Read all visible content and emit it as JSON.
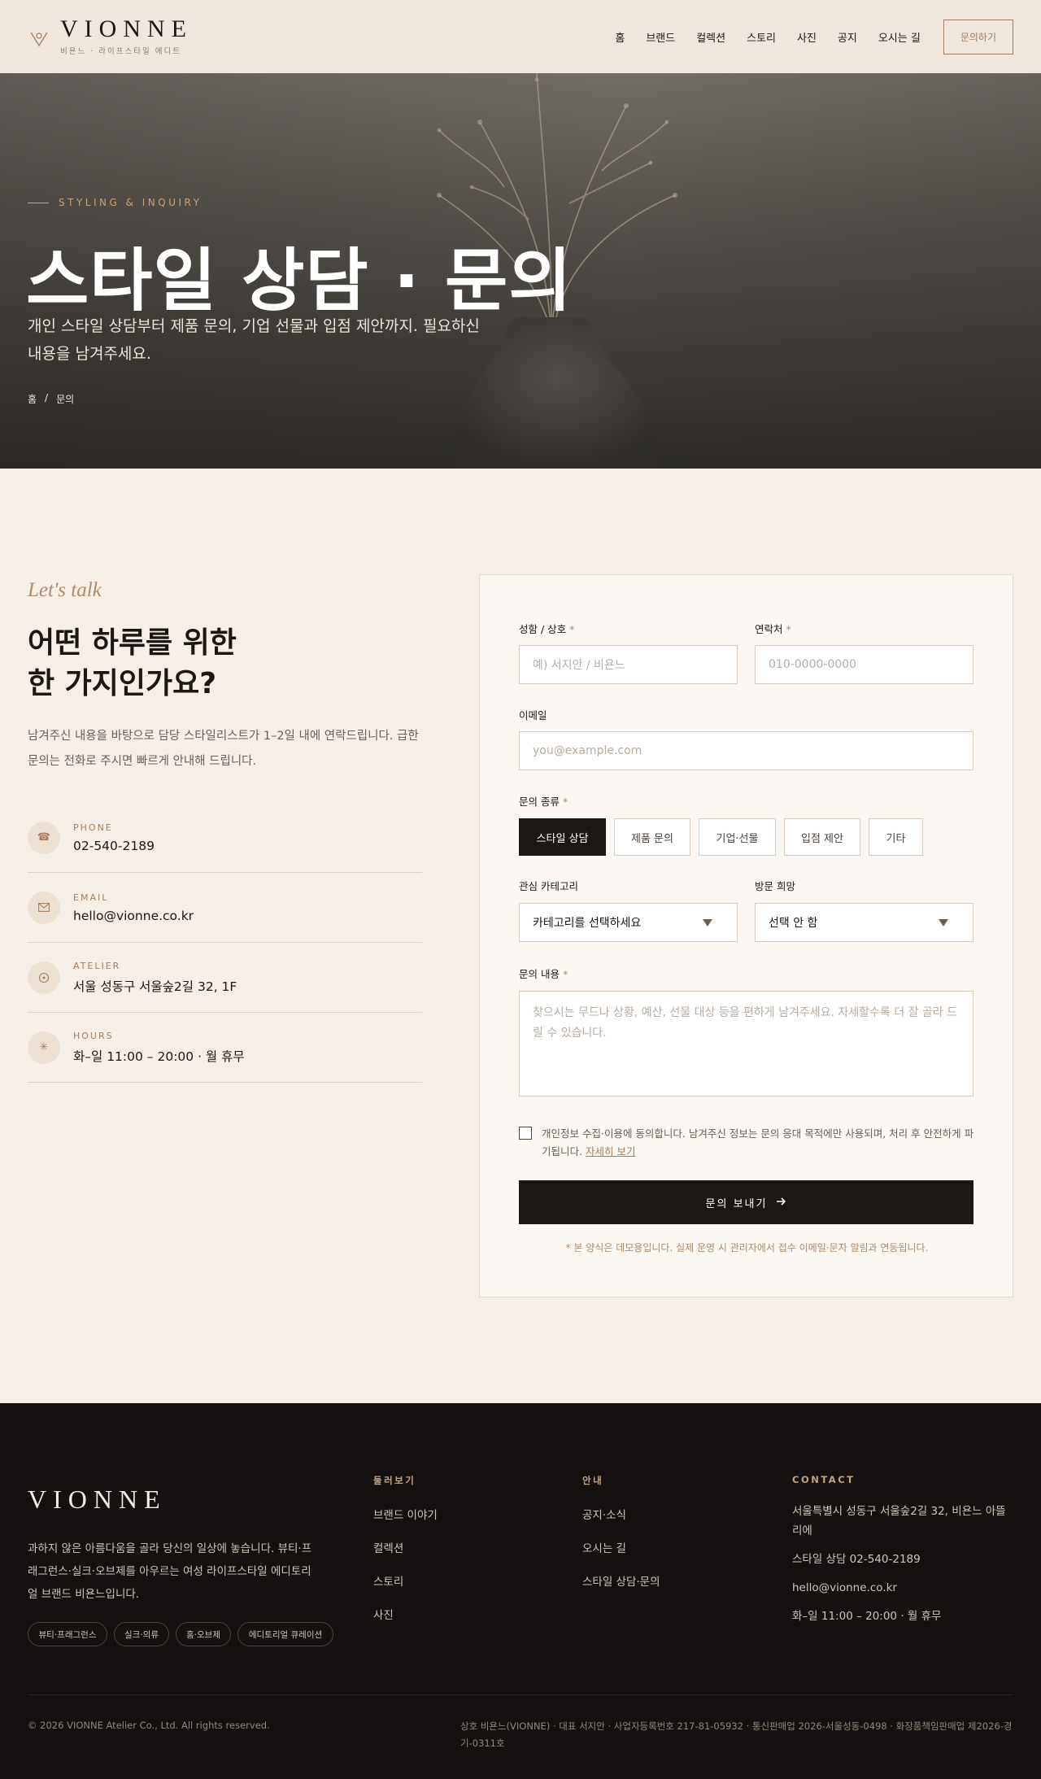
{
  "brand": {
    "name": "VIONNE",
    "tagline": "비욘느 · 라이프스타일 에디트"
  },
  "nav": {
    "items": [
      "홈",
      "브랜드",
      "컬렉션",
      "스토리",
      "사진",
      "공지",
      "오시는 길"
    ],
    "cta": "문의하기"
  },
  "hero": {
    "eyebrow": "STYLING & INQUIRY",
    "title": "스타일 상담 · 문의",
    "description": "개인 스타일 상담부터 제품 문의, 기업 선물과 입점 제안까지. 필요하신 내용을 남겨주세요.",
    "breadcrumb": {
      "home": "홈",
      "separator": "/",
      "current": "문의"
    }
  },
  "contact": {
    "script_heading": "Let's talk",
    "heading_line1": "어떤 하루를 위한",
    "heading_line2": "한 가지인가요?",
    "description": "남겨주신 내용을 바탕으로 담당 스타일리스트가 1–2일 내에 연락드립니다. 급한 문의는 전화로 주시면 빠르게 안내해 드립니다.",
    "items": [
      {
        "icon": "phone-icon",
        "label": "PHONE",
        "value": "02-540-2189"
      },
      {
        "icon": "mail-icon",
        "label": "EMAIL",
        "value": "hello@vionne.co.kr"
      },
      {
        "icon": "location-icon",
        "label": "ATELIER",
        "value": "서울 성동구 서울숲2길 32, 1F"
      },
      {
        "icon": "sun-icon",
        "label": "HOURS",
        "value": "화–일 11:00 – 20:00 · 월 휴무"
      }
    ]
  },
  "form": {
    "required_mark": "*",
    "name": {
      "label": "성함 / 상호",
      "placeholder": "예) 서지안 / 비욘느"
    },
    "phone": {
      "label": "연락처",
      "placeholder": "010-0000-0000"
    },
    "email": {
      "label": "이메일",
      "placeholder": "you@example.com"
    },
    "type": {
      "label": "문의 종류",
      "options": [
        "스타일 상담",
        "제품 문의",
        "기업·선물",
        "입점 제안",
        "기타"
      ],
      "selected": 0
    },
    "category": {
      "label": "관심 카테고리",
      "value": "카테고리를 선택하세요"
    },
    "visit": {
      "label": "방문 희망",
      "value": "선택 안 함"
    },
    "message": {
      "label": "문의 내용",
      "placeholder": "찾으시는 무드나 상황, 예산, 선물 대상 등을 편하게 남겨주세요. 자세할수록 더 잘 골라 드릴 수 있습니다."
    },
    "agree": {
      "text": "개인정보 수집·이용에 동의합니다. 남겨주신 정보는 문의 응대 목적에만 사용되며, 처리 후 안전하게 파기됩니다.",
      "link": "자세히 보기"
    },
    "submit": "문의 보내기",
    "note": "* 본 양식은 데모용입니다. 실제 운영 시 관리자에서 접수 이메일·문자 알림과 연동됩니다."
  },
  "footer": {
    "logo": "VIONNE",
    "description": "과하지 않은 아름다움을 골라 당신의 일상에 놓습니다. 뷰티·프래그런스·실크·오브제를 아우르는 여성 라이프스타일 에디토리얼 브랜드 비욘느입니다.",
    "tags": [
      "뷰티·프래그런스",
      "실크·의류",
      "홈·오브제",
      "에디토리얼 큐레이션"
    ],
    "explore": {
      "heading": "둘러보기",
      "links": [
        "브랜드 이야기",
        "컬렉션",
        "스토리",
        "사진"
      ]
    },
    "guide": {
      "heading": "안내",
      "links": [
        "공지·소식",
        "오시는 길",
        "스타일 상담·문의"
      ]
    },
    "contact": {
      "heading": "CONTACT",
      "address": "서울특별시 성동구 서울숲2길 32, 비욘느 아뜰리에",
      "phone": "스타일 상담 02-540-2189",
      "email": "hello@vionne.co.kr",
      "hours": "화–일 11:00 – 20:00 · 월 휴무"
    },
    "copyright": "© 2026 VIONNE Atelier Co., Ltd. All rights reserved.",
    "business": "상호 비욘느(VIONNE) · 대표 서지안 · 사업자등록번호 217-81-05932 · 통신판매업 2026-서울성동-0498 · 화장품책임판매업 제2026-경기-0311호"
  },
  "colors": {
    "accent": "#a57d5d",
    "ink": "#1c1714",
    "cream": "#f6efe7",
    "footer": "#141110"
  }
}
